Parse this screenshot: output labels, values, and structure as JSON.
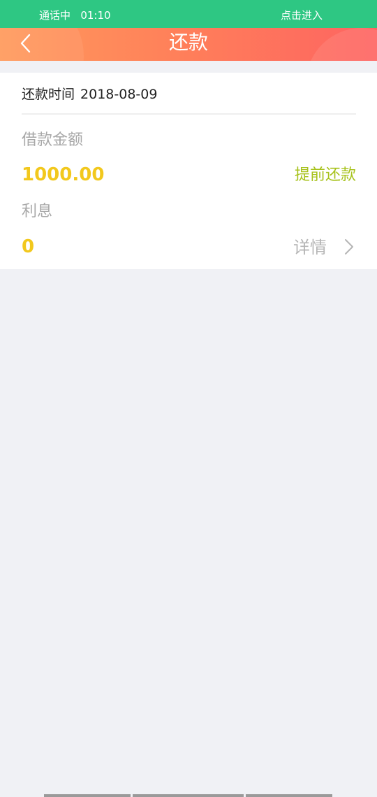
{
  "call_bar": {
    "status_label": "通话中",
    "time": "01:10",
    "enter_label": "点击进入",
    "color": "#2ec783"
  },
  "header": {
    "title": "还款",
    "back_icon": "chevron-left-icon",
    "gradient_start": "#ff9a5c",
    "gradient_end": "#fe6461"
  },
  "card": {
    "repay_time_label": "还款时间",
    "repay_time_value": "2018-08-09",
    "loan_amount_label": "借款金额",
    "loan_amount_value": "1000.00",
    "prepay_label": "提前还款",
    "interest_label": "利息",
    "interest_value": "0",
    "detail_label": "详情",
    "detail_icon": "chevron-right-icon",
    "amount_color": "#f2c81d",
    "prepay_color": "#a7c21b"
  }
}
